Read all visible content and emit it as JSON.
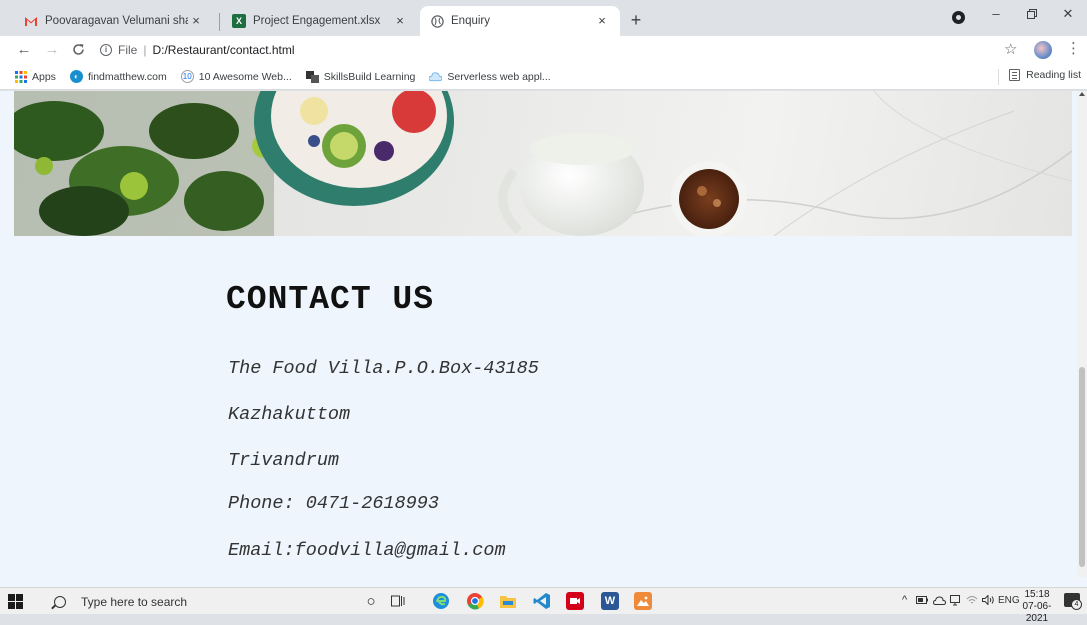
{
  "browser": {
    "tabs": [
      {
        "title": "Poovaragavan Velumani shared ",
        "favicon": "gmail-icon"
      },
      {
        "title": "Project Engagement.xlsx",
        "favicon": "excel-icon"
      },
      {
        "title": "Enquiry",
        "favicon": "globe-icon"
      }
    ],
    "close_glyph": "×",
    "new_tab_glyph": "+",
    "address": {
      "scheme_label": "File",
      "url": "D:/Restaurant/contact.html"
    },
    "bookmarks": [
      {
        "label": "Apps",
        "icon": "apps-grid-icon"
      },
      {
        "label": "findmatthew.com",
        "icon": "findmatthew-icon"
      },
      {
        "label": "10 Awesome Web...",
        "icon": "web-icon"
      },
      {
        "label": "SkillsBuild Learning",
        "icon": "skillsbuild-icon"
      },
      {
        "label": "Serverless web appl...",
        "icon": "serverless-icon"
      }
    ],
    "reading_list_label": "Reading list"
  },
  "page": {
    "hero_image": "food-bowl-hero-image",
    "contact_title": "CONTACT US",
    "address_lines": [
      "The Food Villa.P.O.Box-43185",
      "Kazhakuttom",
      "Trivandrum",
      "Phone: 0471-2618993",
      "Email:foodvilla@gmail.com"
    ]
  },
  "taskbar": {
    "search_placeholder": "Type here to search",
    "tray": {
      "language": "ENG",
      "time": "15:18",
      "date": "07-06-2021",
      "notifications_count": "4"
    }
  },
  "colors": {
    "page_background": "#eef5fd",
    "tab_strip": "#dee1e6"
  }
}
